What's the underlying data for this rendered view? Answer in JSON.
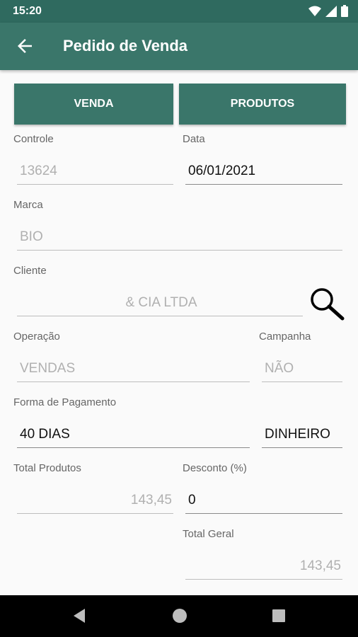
{
  "status_bar": {
    "time": "15:20"
  },
  "app_bar": {
    "title": "Pedido de Venda"
  },
  "tabs": [
    {
      "label": "VENDA"
    },
    {
      "label": "PRODUTOS"
    }
  ],
  "form": {
    "controle": {
      "label": "Controle",
      "value": "13624"
    },
    "data": {
      "label": "Data",
      "value": "06/01/2021"
    },
    "marca": {
      "label": "Marca",
      "value": "BIO"
    },
    "cliente": {
      "label": "Cliente",
      "value": "& CIA LTDA"
    },
    "operacao": {
      "label": "Operação",
      "value": "VENDAS"
    },
    "campanha": {
      "label": "Campanha",
      "value": "NÃO"
    },
    "forma_pagamento": {
      "label": "Forma de Pagamento",
      "value": "40 DIAS",
      "value2": "DINHEIRO"
    },
    "total_produtos": {
      "label": "Total Produtos",
      "value": "143,45"
    },
    "desconto": {
      "label": "Desconto (%)",
      "value": "0"
    },
    "total_geral": {
      "label": "Total Geral",
      "value": "143,45"
    }
  }
}
